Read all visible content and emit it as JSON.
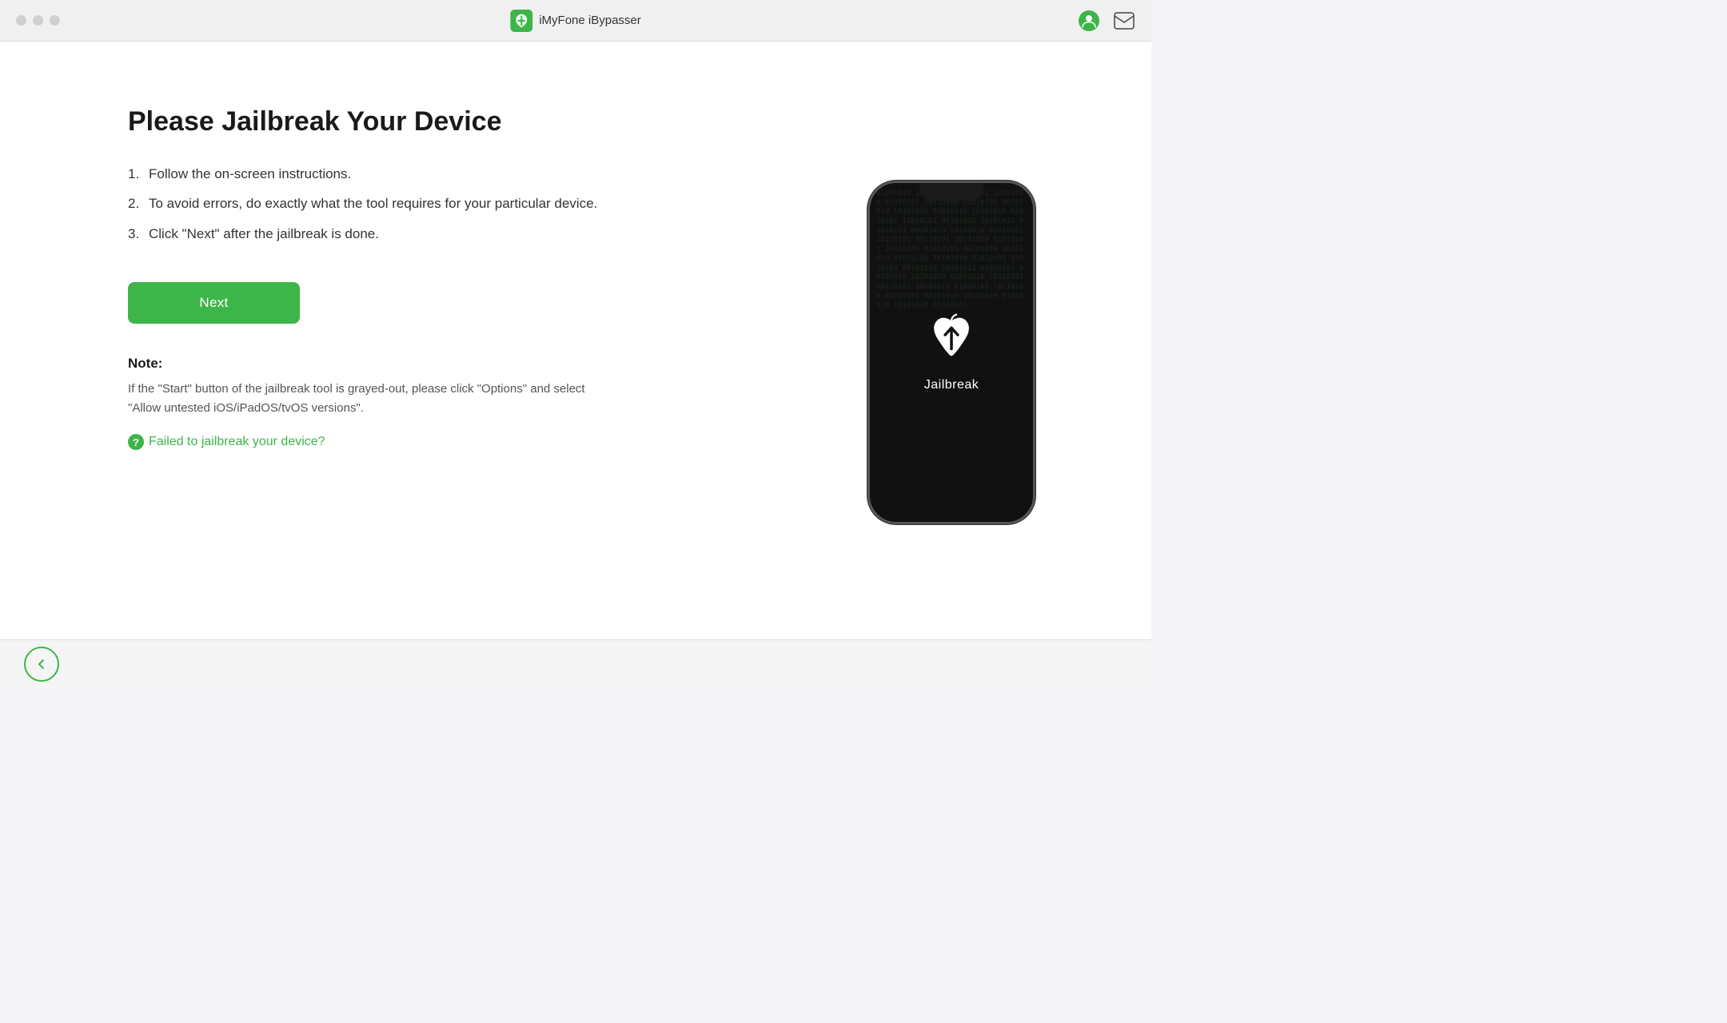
{
  "titlebar": {
    "app_name": "iMyFone iBypasser",
    "traffic_lights": [
      "close",
      "minimize",
      "maximize"
    ]
  },
  "main": {
    "heading": "Please Jailbreak Your Device",
    "instructions": [
      {
        "num": "1.",
        "text": "Follow the on-screen instructions."
      },
      {
        "num": "2.",
        "text": "To avoid errors, do exactly what the tool requires for your particular device."
      },
      {
        "num": "3.",
        "text": "Click \"Next\" after the jailbreak is done."
      }
    ],
    "next_button_label": "Next",
    "note_label": "Note:",
    "note_text": "If the \"Start\" button of the jailbreak tool is grayed-out, please click \"Options\" and select \"Allow untested iOS/iPadOS/tvOS versions\".",
    "failed_link_text": "Failed to jailbreak your device?",
    "phone_label": "Jailbreak",
    "matrix_text": "01001010 10110101 00110101 10101010 01010101 10110100 01010101 00101010 10101010 01010110 10101010 01010101 11010101 00101010 10101011 01010101 00101010 10101010 01010101 10110101 00110101 10101010"
  },
  "bottom": {
    "back_button_label": "←"
  }
}
